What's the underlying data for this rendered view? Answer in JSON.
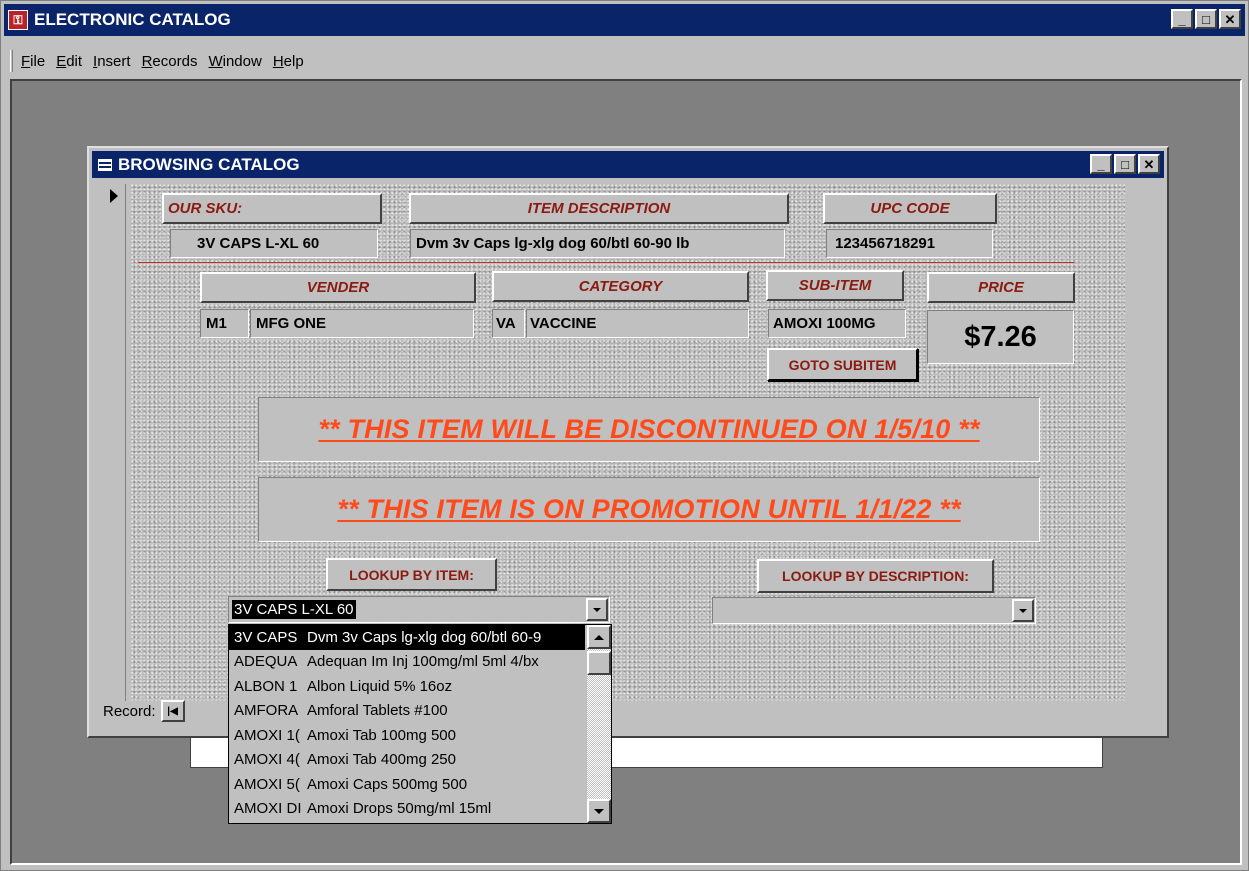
{
  "app": {
    "title": "ELECTRONIC CATALOG",
    "menu": [
      "File",
      "Edit",
      "Insert",
      "Records",
      "Window",
      "Help"
    ]
  },
  "window_buttons": {
    "minimize": "_",
    "maximize": "□",
    "close": "✕"
  },
  "form": {
    "title": "BROWSING CATALOG",
    "labels": {
      "sku": "OUR SKU:",
      "description": "ITEM DESCRIPTION",
      "upc": "UPC CODE",
      "vender": "VENDER",
      "category": "CATEGORY",
      "subitem": "SUB-ITEM",
      "price": "PRICE"
    },
    "values": {
      "sku": "3V CAPS L-XL 60",
      "description": "Dvm 3v Caps lg-xlg dog 60/btl 60-90 lb",
      "upc": "123456718291",
      "vender_code": "M1",
      "vender_name": "MFG ONE",
      "category_code": "VA",
      "category_name": "VACCINE",
      "subitem": "AMOXI 100MG",
      "price": "$7.26"
    },
    "goto_subitem": "GOTO SUBITEM",
    "notice_discontinued": "** THIS ITEM WILL BE DISCONTINUED ON 1/5/10 **",
    "notice_promotion": "** THIS ITEM IS ON PROMOTION UNTIL 1/1/22 **",
    "lookup_item_label": "LOOKUP BY ITEM:",
    "lookup_desc_label": "LOOKUP BY DESCRIPTION:",
    "lookup_item_value": "3V CAPS L-XL 60",
    "lookup_desc_value": "",
    "record_label": "Record:",
    "dropdown_items": [
      {
        "code": "3V CAPS",
        "desc": "Dvm 3v Caps lg-xlg dog 60/btl 60-9"
      },
      {
        "code": "ADEQUA",
        "desc": "Adequan Im Inj 100mg/ml 5ml 4/bx"
      },
      {
        "code": "ALBON 1",
        "desc": "Albon Liquid 5% 16oz"
      },
      {
        "code": "AMFORA",
        "desc": "Amforal Tablets #100"
      },
      {
        "code": "AMOXI 1(",
        "desc": "Amoxi Tab 100mg 500"
      },
      {
        "code": "AMOXI 4(",
        "desc": "Amoxi Tab 400mg 250"
      },
      {
        "code": "AMOXI 5(",
        "desc": "Amoxi Caps 500mg 500"
      },
      {
        "code": "AMOXI DI",
        "desc": "Amoxi Drops 50mg/ml 15ml"
      }
    ]
  },
  "colors": {
    "titlebar": "#0a246a",
    "label_text": "#8b1a10",
    "notice_text": "#ff4a1c"
  }
}
